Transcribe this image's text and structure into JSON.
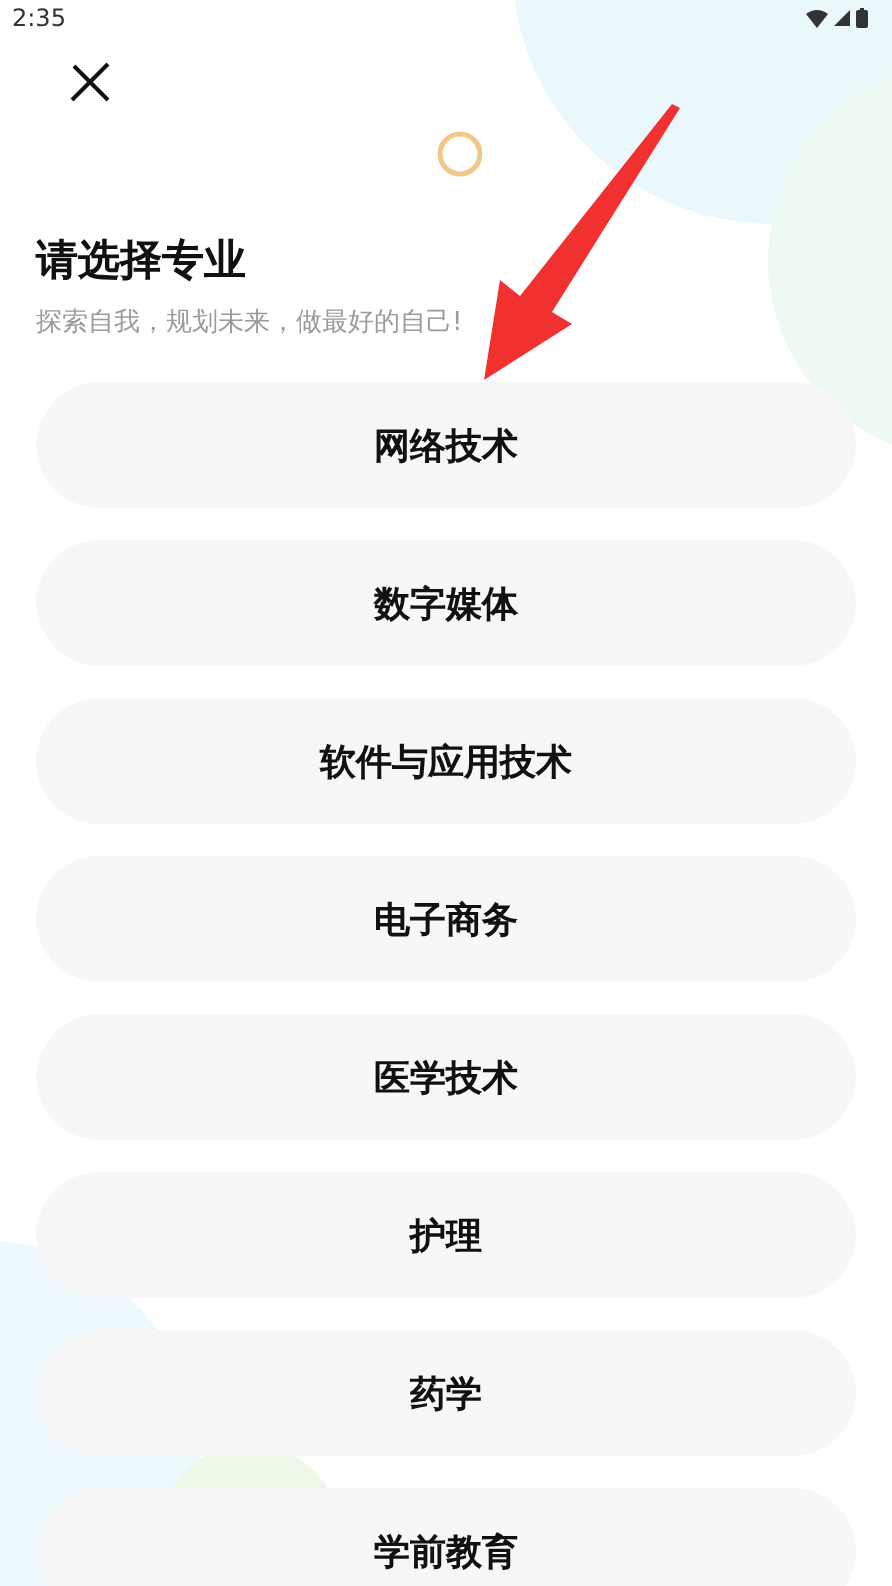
{
  "status_bar": {
    "time": "2:35"
  },
  "title": "请选择专业",
  "subtitle": "探索自我，规划未来，做最好的自己!",
  "majors": [
    {
      "label": "网络技术"
    },
    {
      "label": "数字媒体"
    },
    {
      "label": "软件与应用技术"
    },
    {
      "label": "电子商务"
    },
    {
      "label": "医学技术"
    },
    {
      "label": "护理"
    },
    {
      "label": "药学"
    },
    {
      "label": "学前教育"
    }
  ]
}
